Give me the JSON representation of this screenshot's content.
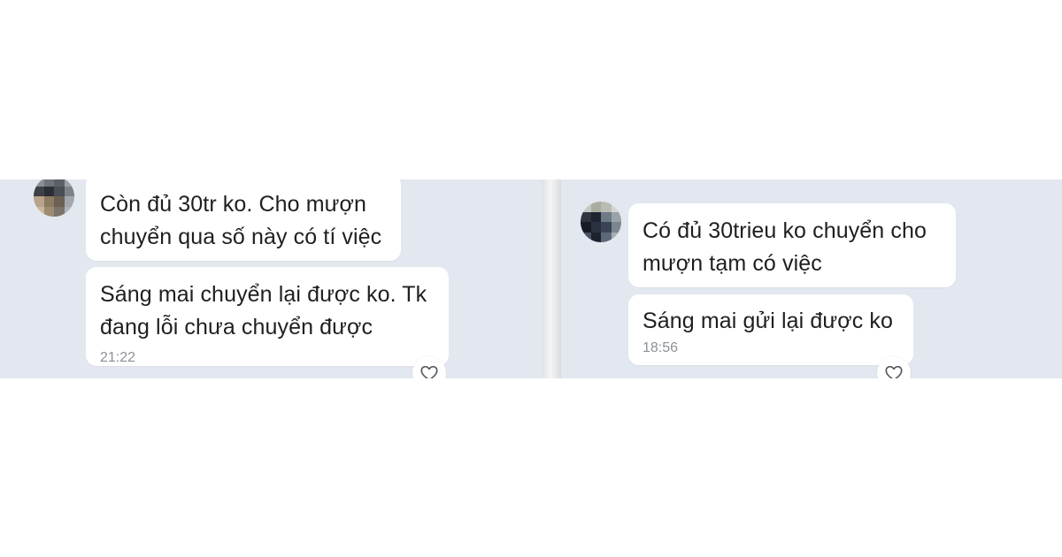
{
  "left_chat": {
    "messages": [
      {
        "text": "Còn đủ 30tr ko. Cho mượn\nchuyển qua số này có tí việc"
      },
      {
        "text": "Sáng mai chuyển lại được ko. Tk\nđang lỗi chưa chuyển được",
        "time": "21:22"
      }
    ],
    "reaction_icon": "heart-outline-icon"
  },
  "right_chat": {
    "messages": [
      {
        "text": "Có đủ 30trieu ko chuyển cho\nmượn tạm có việc"
      },
      {
        "text": "Sáng mai gửi lại được ko",
        "time": "18:56"
      }
    ],
    "reaction_icon": "heart-outline-icon"
  },
  "colors": {
    "chat_background": "#e3e7ef",
    "bubble": "#ffffff",
    "text": "#1f1f1f",
    "timestamp": "#8c9098"
  }
}
